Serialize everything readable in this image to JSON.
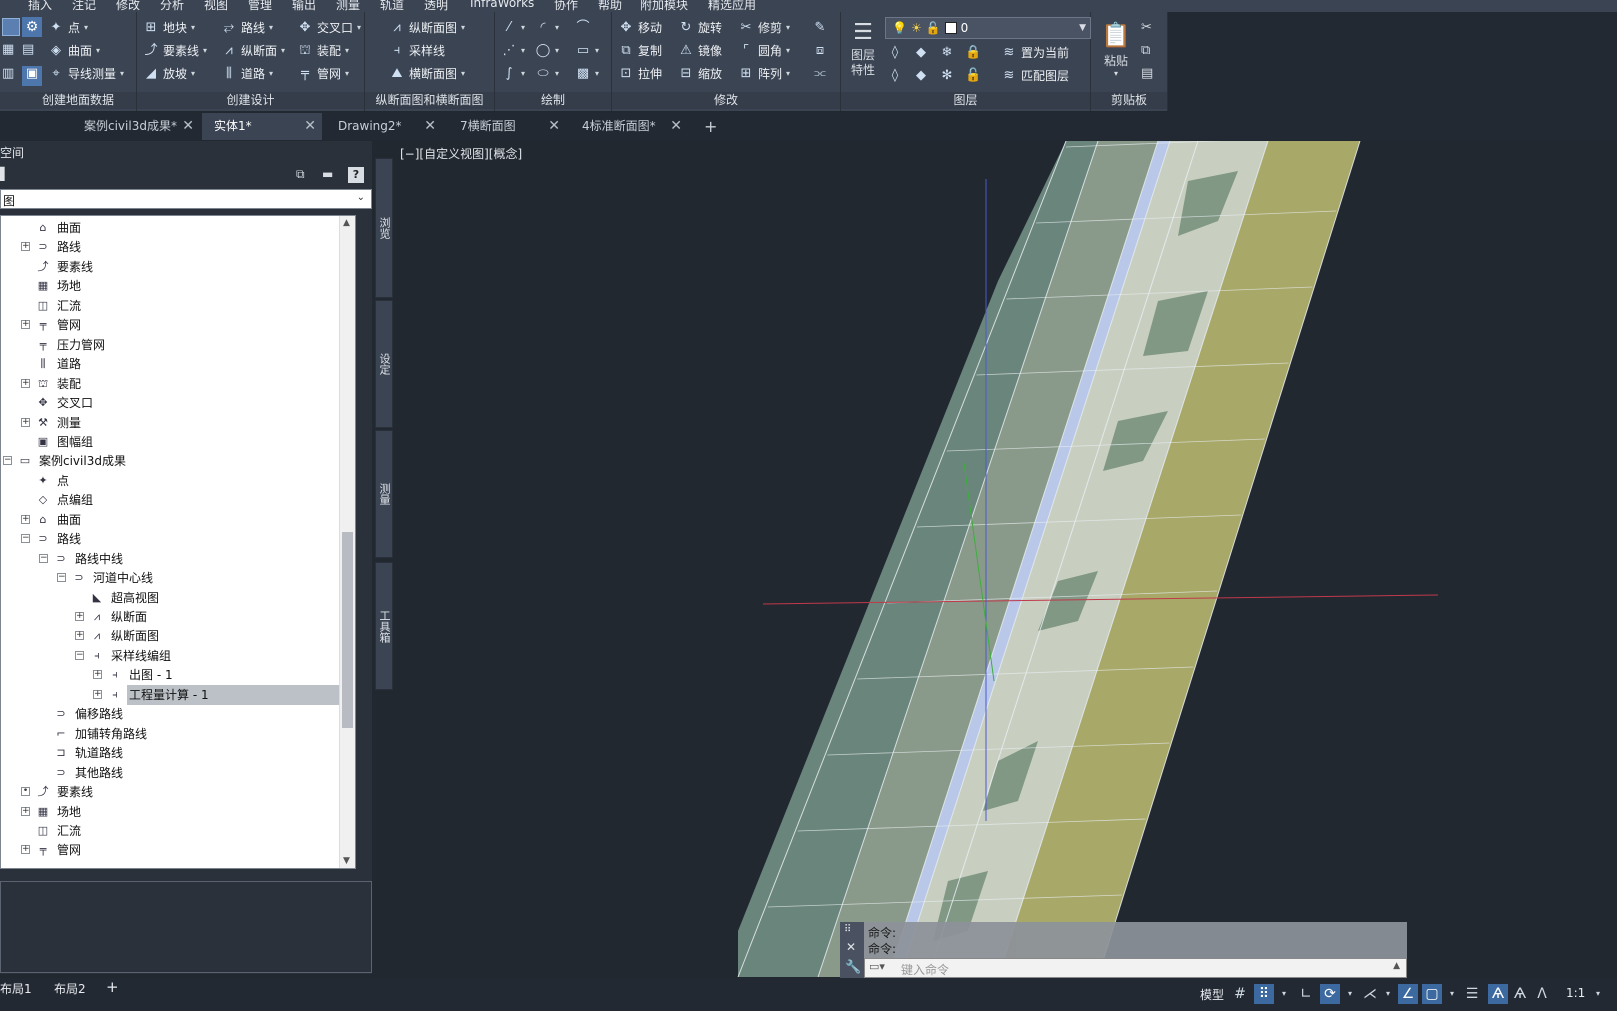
{
  "menubar": {
    "items": [
      "插入",
      "注记",
      "修改",
      "分析",
      "视图",
      "管理",
      "输出",
      "测量",
      "轨道",
      "透明",
      "InfraWorks",
      "协作",
      "帮助",
      "附加模块",
      "精选应用"
    ]
  },
  "ribbon": {
    "panels": {
      "ground": {
        "title": "创建地面数据",
        "items": [
          "点",
          "曲面",
          "导线测量"
        ]
      },
      "design": {
        "title": "创建设计",
        "items": [
          "地块",
          "要素线",
          "放坡",
          "路线",
          "纵断面",
          "道路",
          "交叉口",
          "装配",
          "管网"
        ]
      },
      "profile": {
        "title": "纵断面图和横断面图",
        "items": [
          "纵断面图",
          "采样线",
          "横断面图"
        ]
      },
      "draw": {
        "title": "绘制"
      },
      "modify": {
        "title": "修改",
        "items": [
          "移动",
          "旋转",
          "修剪",
          "复制",
          "镜像",
          "圆角",
          "拉伸",
          "缩放",
          "阵列"
        ]
      },
      "layer": {
        "title": "图层",
        "props_label": "图层特性",
        "layer_value": "0",
        "set_current": "置为当前",
        "match_layer": "匹配图层"
      },
      "clipboard": {
        "title": "剪贴板",
        "paste": "粘贴"
      }
    }
  },
  "tabs": [
    {
      "label": "案例civil3d成果*",
      "active": false
    },
    {
      "label": "实体1*",
      "active": true
    },
    {
      "label": "Drawing2*",
      "active": false
    },
    {
      "label": "7横断面图",
      "active": false
    },
    {
      "label": "4标准断面图*",
      "active": false
    }
  ],
  "new_tab": "+",
  "palette": {
    "header": "空间",
    "dropdown_value": "图",
    "side_tabs": [
      "浏览",
      "设定",
      "测量",
      "工具箱"
    ],
    "tree": [
      {
        "label": "曲面",
        "icon": "surface-icon"
      },
      {
        "label": "路线",
        "icon": "alignment-icon"
      },
      {
        "label": "要素线",
        "icon": "featureline-icon"
      },
      {
        "label": "场地",
        "icon": "site-icon"
      },
      {
        "label": "汇流",
        "icon": "catchment-icon"
      },
      {
        "label": "管网",
        "icon": "pipe-network-icon"
      },
      {
        "label": "压力管网",
        "icon": "pressure-network-icon"
      },
      {
        "label": "道路",
        "icon": "corridor-icon"
      },
      {
        "label": "装配",
        "icon": "assembly-icon"
      },
      {
        "label": "交叉口",
        "icon": "intersection-icon"
      },
      {
        "label": "测量",
        "icon": "survey-icon"
      },
      {
        "label": "图幅组",
        "icon": "sheet-set-icon"
      },
      {
        "label": "案例civil3d成果",
        "icon": "drawing-icon"
      },
      {
        "label": "点",
        "icon": "point-icon"
      },
      {
        "label": "点编组",
        "icon": "point-group-icon"
      },
      {
        "label": "曲面",
        "icon": "surface-icon"
      },
      {
        "label": "路线",
        "icon": "alignment-icon"
      },
      {
        "label": "路线中线",
        "icon": "centerline-icon"
      },
      {
        "label": "河道中心线",
        "icon": "alignment-icon"
      },
      {
        "label": "超高视图",
        "icon": "superelevation-icon"
      },
      {
        "label": "纵断面",
        "icon": "profile-icon"
      },
      {
        "label": "纵断面图",
        "icon": "profile-view-icon"
      },
      {
        "label": "采样线编组",
        "icon": "sample-line-group-icon"
      },
      {
        "label": "出图 - 1",
        "icon": "sample-line-icon"
      },
      {
        "label": "工程量计算 - 1",
        "icon": "sample-line-icon"
      },
      {
        "label": "偏移路线",
        "icon": "offset-alignment-icon"
      },
      {
        "label": "加铺转角路线",
        "icon": "curb-return-icon"
      },
      {
        "label": "轨道路线",
        "icon": "rail-icon"
      },
      {
        "label": "其他路线",
        "icon": "misc-alignment-icon"
      },
      {
        "label": "要素线",
        "icon": "featureline-icon"
      },
      {
        "label": "场地",
        "icon": "site-icon"
      },
      {
        "label": "汇流",
        "icon": "catchment-icon"
      },
      {
        "label": "管网",
        "icon": "pipe-network-icon"
      }
    ]
  },
  "viewport": {
    "label": "[−][自定义视图][概念]"
  },
  "command": {
    "history": [
      "命令:",
      "命令:"
    ],
    "placeholder": "键入命令"
  },
  "statusbar": {
    "layouts": [
      "布局1",
      "布局2"
    ],
    "add_layout": "+",
    "model": "模型",
    "scale": "1:1"
  }
}
